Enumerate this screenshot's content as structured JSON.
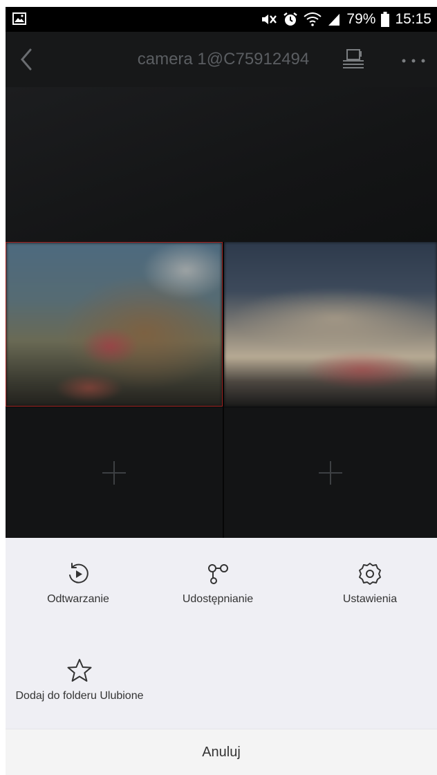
{
  "status_bar": {
    "left_icon": "image-icon",
    "icons": [
      "mute-icon",
      "alarm-icon",
      "wifi-icon",
      "signal-icon"
    ],
    "battery_percent": "79%",
    "time": "15:15"
  },
  "header": {
    "title": "camera 1@C75912494",
    "back_icon": "chevron-left-icon",
    "multi_screen_icon": "multi-screen-icon",
    "more_icon": "more-icon"
  },
  "grid": {
    "add_icon": "plus-icon"
  },
  "actions": {
    "playback_label": "Odtwarzanie",
    "share_label": "Udostępnianie",
    "settings_label": "Ustawienia",
    "favorite_label": "Dodaj do folderu Ulubione"
  },
  "cancel_label": "Anuluj",
  "colors": {
    "selected_border": "#a0211f",
    "header_bg": "#171819",
    "sheet_bg": "#efeff4"
  }
}
